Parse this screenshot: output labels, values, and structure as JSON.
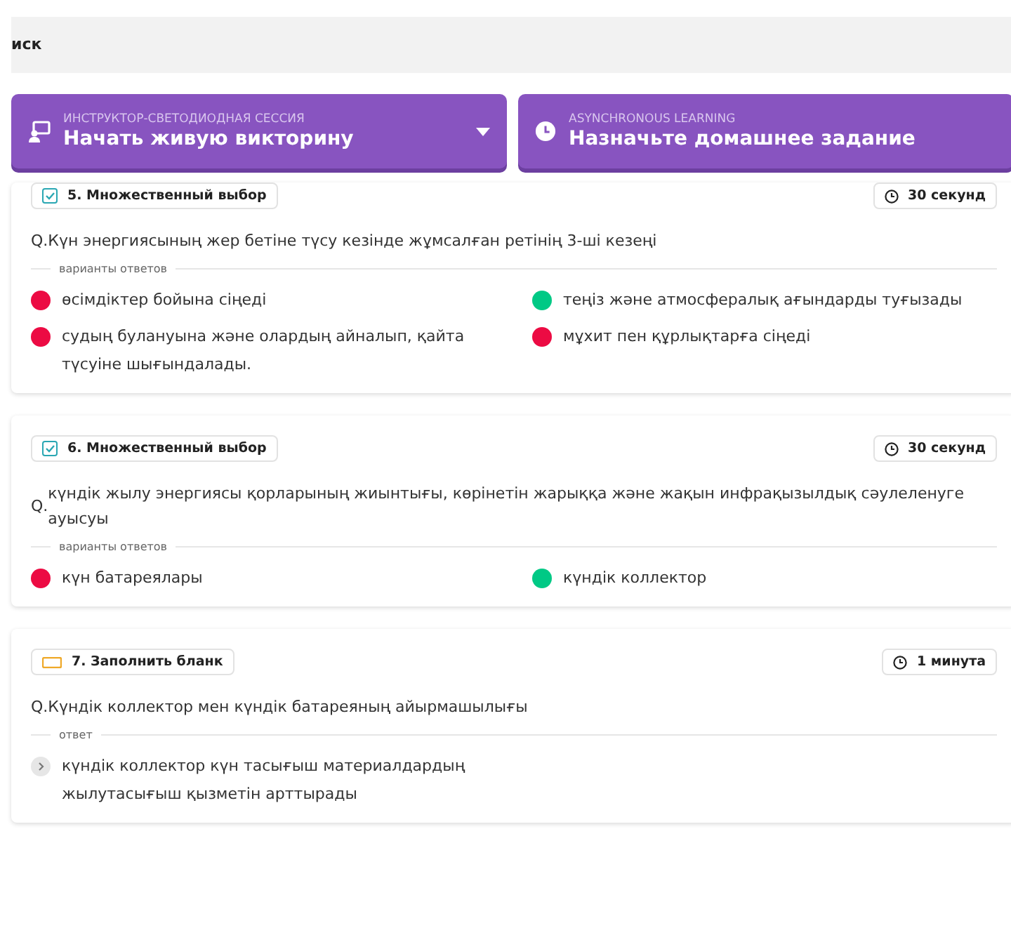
{
  "search": {
    "value": "иск"
  },
  "actions": [
    {
      "kind": "live",
      "caption": "ИНСТРУКТОР-СВЕТОДИОДНАЯ СЕССИЯ",
      "label": "Начать живую викторину",
      "dropdown": true
    },
    {
      "kind": "homework",
      "caption": "ASYNCHRONOUS LEARNING",
      "label": "Назначьте домашнее задание",
      "dropdown": false
    }
  ],
  "questions": [
    {
      "kind": "multiple_choice",
      "type_label": "5. Множественный выбор",
      "time": "30 секунд",
      "prefix": "Q.",
      "text": "Күн энергиясының жер бетіне түсу кезінде жұмсалған ретінің 3-ші кезеңі",
      "section_label": "варианты ответов",
      "options": [
        {
          "text": "өсімдіктер бойына сіңеді",
          "correct": false
        },
        {
          "text": "теңіз және атмосфералық ағындарды туғызады",
          "correct": true
        },
        {
          "text": "судың булануына және олардың айналып, қайта түсуіне шығындалады.",
          "correct": false
        },
        {
          "text": "мұхит пен құрлықтарға сіңеді",
          "correct": false
        }
      ]
    },
    {
      "kind": "multiple_choice",
      "type_label": "6. Множественный выбор",
      "time": "30 секунд",
      "prefix": "Q.",
      "text": "күндік жылу энергиясы қорларының жиынтығы, көрінетін жарыққа және жақын инфрақызылдық сәулеленуге ауысуы",
      "section_label": "варианты ответов",
      "options": [
        {
          "text": "күн батареялары",
          "correct": false
        },
        {
          "text": "күндік коллектор",
          "correct": true
        }
      ]
    },
    {
      "kind": "fill_blank",
      "type_label": "7. Заполнить бланк",
      "time": "1 минута",
      "prefix": "Q.",
      "text": "Күндік коллектор мен күндік батареяның айырмашылығы",
      "section_label": "ответ",
      "answers": [
        {
          "text": "күндік коллектор күн тасығыш материалдардың жылутасығыш қызметін арттырады"
        }
      ]
    }
  ]
}
